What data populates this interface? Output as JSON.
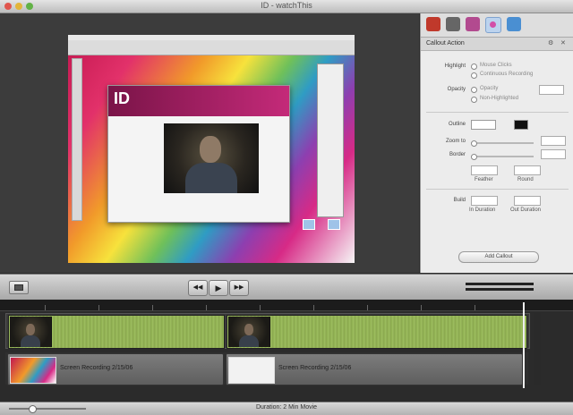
{
  "window": {
    "title": "ID - watchThis"
  },
  "recording": {
    "app_logo_text": "ID",
    "desktop_icons": [
      "folder",
      "disk"
    ]
  },
  "inspector": {
    "tabs": [
      "Video",
      "Audio",
      "Callout",
      "Cursor",
      "Screen"
    ],
    "active_tab": "Cursor",
    "section_title": "Callout Action",
    "highlight_label": "Highlight",
    "highlight_options": [
      "Mouse Clicks",
      "Continuous Recording"
    ],
    "opacity_label": "Opacity",
    "opacity_options": [
      "Opacity",
      "Non-Highlighted"
    ],
    "outline_label": "Outline",
    "zoom_label": "Zoom to",
    "border_label": "Border",
    "feather_label": "Feather",
    "round_label": "Round",
    "build_label": "Build",
    "in_duration_label": "In Duration",
    "out_duration_label": "Out Duration",
    "add_button": "Add Callout",
    "colors": {
      "outline_light": "#ffffff",
      "outline_dark": "#111111"
    }
  },
  "transport": {
    "rewind": "◀◀",
    "play": "▶",
    "forward": "▶▶"
  },
  "timeline": {
    "screen_clips": [
      {
        "label": "Screen Recording 2/15/06"
      },
      {
        "label": "Screen Recording 2/15/06"
      }
    ]
  },
  "status": {
    "duration": "Duration: 2 Min Movie"
  }
}
